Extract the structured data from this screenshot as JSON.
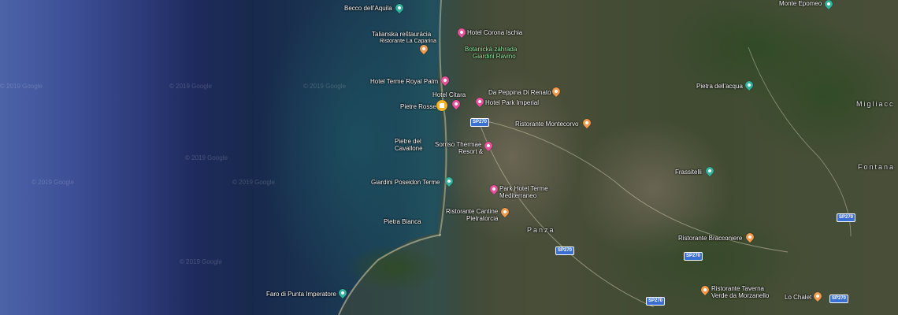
{
  "map": {
    "watermark": "© 2019 Google",
    "places": [
      {
        "id": "becco",
        "label": "Becco dell'Aquila",
        "kind": "park"
      },
      {
        "id": "monte-epomeo",
        "label": "Monte Epomeo",
        "kind": "park"
      },
      {
        "id": "talianska",
        "label": "Talianska reštaurácia",
        "kind": "text"
      },
      {
        "id": "caparina",
        "label": "Ristorante La Caparina",
        "kind": "food"
      },
      {
        "id": "corona",
        "label": "Hotel Corona Ischia",
        "kind": "hotel"
      },
      {
        "id": "botanicka1",
        "label": "Botanická záhrada",
        "kind": "text"
      },
      {
        "id": "botanicka2",
        "label": "Giardini Ravino",
        "kind": "text"
      },
      {
        "id": "royal-palm",
        "label": "Hotel Terme Royal Palm",
        "kind": "hotel"
      },
      {
        "id": "peppina",
        "label": "Da Peppina Di Renato",
        "kind": "food"
      },
      {
        "id": "pietra-acqua",
        "label": "Pietra dell'acqua",
        "kind": "park"
      },
      {
        "id": "citara",
        "label": "Hotel Citara",
        "kind": "hotel"
      },
      {
        "id": "pietre-rosse",
        "label": "Pietre Rosse",
        "kind": "home"
      },
      {
        "id": "park-imperial",
        "label": "Hotel Park Imperial",
        "kind": "hotel"
      },
      {
        "id": "montecorvo",
        "label": "Ristorante Montecorvo",
        "kind": "food"
      },
      {
        "id": "cavallone1",
        "label": "Pietre del",
        "kind": "text"
      },
      {
        "id": "cavallone2",
        "label": "Cavallone",
        "kind": "text"
      },
      {
        "id": "sorriso1",
        "label": "Sorriso Thermae",
        "kind": "hotel"
      },
      {
        "id": "sorriso2",
        "label": "Resort &",
        "kind": "text"
      },
      {
        "id": "frassitelli",
        "label": "Frassitelli",
        "kind": "park"
      },
      {
        "id": "poseidon",
        "label": "Giardini Poseidon Terme",
        "kind": "park"
      },
      {
        "id": "mediterraneo1",
        "label": "Park Hotel Terme",
        "kind": "hotel"
      },
      {
        "id": "mediterraneo2",
        "label": "Mediterraneo",
        "kind": "text"
      },
      {
        "id": "cantine1",
        "label": "Ristorante Cantine",
        "kind": "food"
      },
      {
        "id": "cantine2",
        "label": "Pietratorcia",
        "kind": "text"
      },
      {
        "id": "pietra-bianca",
        "label": "Pietra Bianca",
        "kind": "text"
      },
      {
        "id": "panza",
        "label": "Panza",
        "kind": "area"
      },
      {
        "id": "bracconiere",
        "label": "Ristorante Bracconiere",
        "kind": "food"
      },
      {
        "id": "faro",
        "label": "Faro di Punta Imperatore",
        "kind": "park"
      },
      {
        "id": "taverna1",
        "label": "Ristorante Taverna",
        "kind": "food"
      },
      {
        "id": "taverna2",
        "label": "Verde da Morzanello",
        "kind": "text"
      },
      {
        "id": "chalet",
        "label": "Lo Chalet",
        "kind": "food"
      },
      {
        "id": "migliaccio",
        "label": "Migliacc",
        "kind": "area"
      },
      {
        "id": "fontana",
        "label": "Fontana",
        "kind": "area"
      }
    ],
    "roads": [
      "SP270",
      "SP270",
      "SP270",
      "SP270",
      "SP270",
      "SP270"
    ],
    "colors": {
      "hotel": "#e8529b",
      "food": "#f29a4e",
      "park": "#30b39a",
      "home": "#f0b32a",
      "road": "#3b6fd1"
    }
  }
}
